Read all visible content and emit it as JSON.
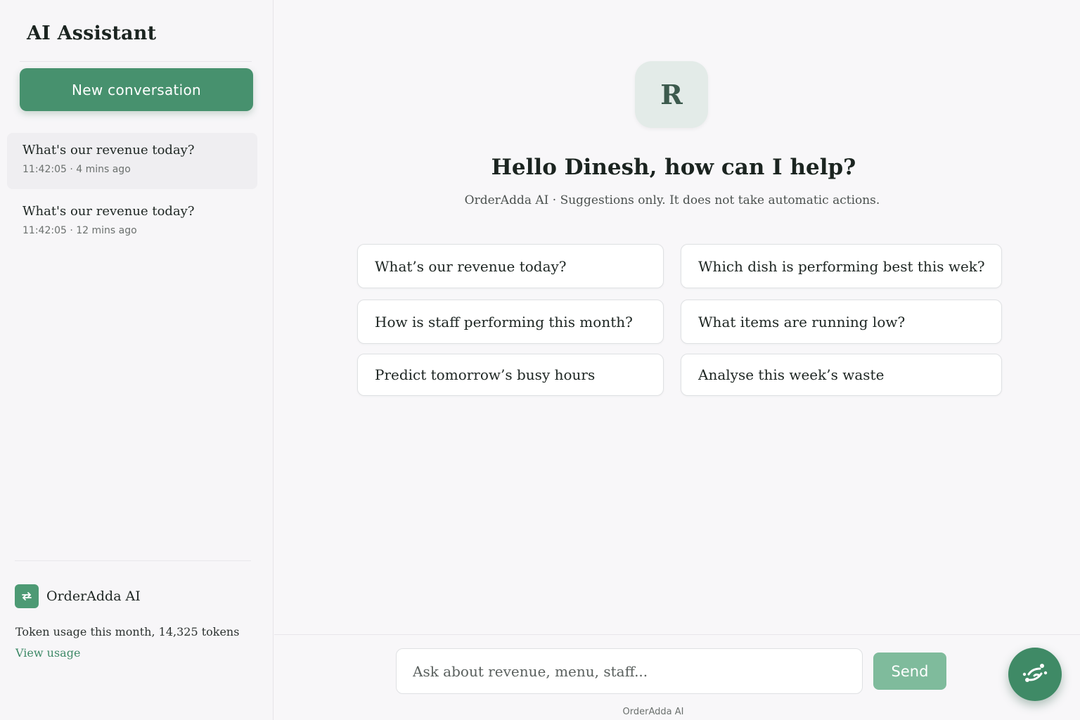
{
  "sidebar": {
    "title": "AI Assistant",
    "new_conversation_label": "New conversation",
    "conversations": [
      {
        "title": "What's our revenue today?",
        "meta": "11:42:05 · 4 mins ago",
        "active": true
      },
      {
        "title": "What's our revenue today?",
        "meta": "11:42:05 · 12 mins ago",
        "active": false
      }
    ],
    "brand_name": "OrderAdda AI",
    "token_usage": "Token usage this month, 14,325 tokens",
    "view_usage_label": "View usage"
  },
  "main": {
    "avatar_letter": "R",
    "greeting": "Hello Dinesh, how can I help?",
    "subtitle": "OrderAdda AI · Suggestions only. It does not take automatic actions.",
    "suggestions": [
      "What’s our revenue today?",
      "Which dish is performing best this wek?",
      "How is staff performing this month?",
      "What items are running low?",
      "Predict tomorrow’s busy hours",
      "Analyse this week’s waste"
    ],
    "input_placeholder": "Ask about revenue, menu, staff...",
    "send_label": "Send",
    "footer_label": "OrderAdda AI"
  },
  "colors": {
    "accent": "#47916e",
    "send_button": "#7fbb9c",
    "fab": "#3f8a66",
    "avatar_bg": "#e3ebe8"
  },
  "icons": {
    "brand_logo": "swap-arrows-icon",
    "fab": "ai-sparkle-icon"
  }
}
